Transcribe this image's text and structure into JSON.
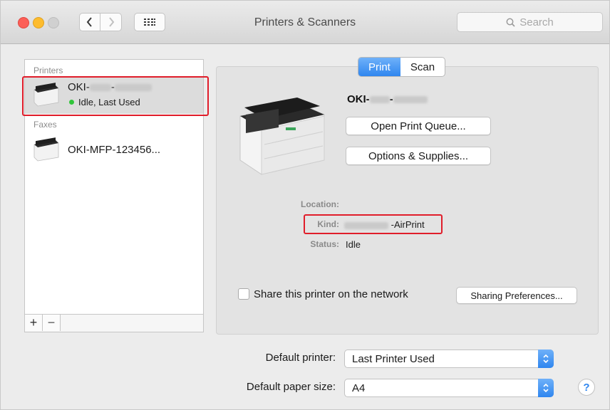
{
  "window": {
    "title": "Printers & Scanners"
  },
  "toolbar": {
    "search_placeholder": "Search"
  },
  "sidebar": {
    "printers_header": "Printers",
    "faxes_header": "Faxes",
    "printer": {
      "name_prefix": "OKI-",
      "name_sep": "-",
      "status": "Idle, Last Used"
    },
    "fax": {
      "name": "OKI-MFP-123456..."
    },
    "add_label": "+",
    "remove_label": "−"
  },
  "tabs": {
    "print": "Print",
    "scan": "Scan"
  },
  "detail": {
    "name_prefix": "OKI-",
    "name_sep": "-",
    "open_queue_label": "Open Print Queue...",
    "options_label": "Options & Supplies...",
    "location_label": "Location:",
    "kind_label": "Kind:",
    "kind_value_suffix": "-AirPrint",
    "status_label": "Status:",
    "status_value": "Idle"
  },
  "sharing": {
    "checkbox_label": "Share this printer on the network",
    "checked": false,
    "prefs_label": "Sharing Preferences..."
  },
  "defaults": {
    "printer_label": "Default printer:",
    "printer_value": "Last Printer Used",
    "paper_label": "Default paper size:",
    "paper_value": "A4"
  },
  "help_label": "?",
  "colors": {
    "accent": "#2f86ef",
    "highlight_box": "#e01d2a",
    "status_green": "#31c53a"
  }
}
